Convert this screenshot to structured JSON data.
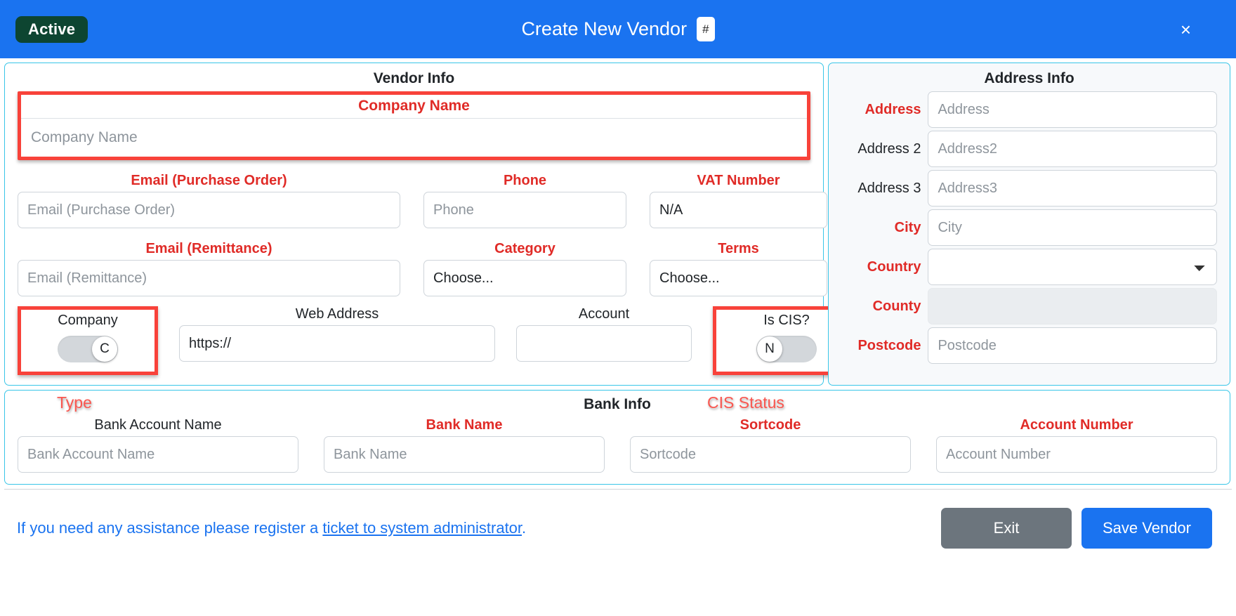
{
  "header": {
    "status_badge": "Active",
    "title": "Create New Vendor",
    "number_badge": "#",
    "close_label": "×",
    "bar_color": "#1a73f0",
    "badge_color": "#0d4531"
  },
  "vendor_info": {
    "title": "Vendor Info",
    "company_name": {
      "label": "Company Name",
      "placeholder": "Company Name",
      "value": "",
      "highlighted": true
    },
    "email_po": {
      "label": "Email (Purchase Order)",
      "placeholder": "Email (Purchase Order)",
      "value": ""
    },
    "phone": {
      "label": "Phone",
      "placeholder": "Phone",
      "value": ""
    },
    "vat_number": {
      "label": "VAT Number",
      "placeholder": "",
      "value": "N/A"
    },
    "email_remittance": {
      "label": "Email (Remittance)",
      "placeholder": "Email (Remittance)",
      "value": ""
    },
    "category": {
      "label": "Category",
      "value": "Choose..."
    },
    "terms": {
      "label": "Terms",
      "value": "Choose..."
    },
    "company_toggle": {
      "label": "Company",
      "state": "on",
      "knob_text": "C",
      "highlighted": true
    },
    "web_address": {
      "label": "Web Address",
      "placeholder": "",
      "value": "https://"
    },
    "account": {
      "label": "Account",
      "placeholder": "",
      "value": ""
    },
    "is_cis_toggle": {
      "label": "Is CIS?",
      "state": "off",
      "knob_text": "N",
      "highlighted": true
    }
  },
  "address_info": {
    "title": "Address Info",
    "fields": [
      {
        "label": "Address",
        "placeholder": "Address",
        "value": "",
        "required": true,
        "type": "text"
      },
      {
        "label": "Address 2",
        "placeholder": "Address2",
        "value": "",
        "required": false,
        "type": "text"
      },
      {
        "label": "Address 3",
        "placeholder": "Address3",
        "value": "",
        "required": false,
        "type": "text"
      },
      {
        "label": "City",
        "placeholder": "City",
        "value": "",
        "required": true,
        "type": "text"
      },
      {
        "label": "Country",
        "placeholder": "",
        "value": "",
        "required": true,
        "type": "select"
      },
      {
        "label": "County",
        "placeholder": "",
        "value": "",
        "required": true,
        "type": "select-disabled"
      },
      {
        "label": "Postcode",
        "placeholder": "Postcode",
        "value": "",
        "required": true,
        "type": "text"
      }
    ]
  },
  "bank_info": {
    "title": "Bank Info",
    "fields": [
      {
        "label": "Bank Account Name",
        "placeholder": "Bank Account Name",
        "value": "",
        "required": false
      },
      {
        "label": "Bank Name",
        "placeholder": "Bank Name",
        "value": "",
        "required": true
      },
      {
        "label": "Sortcode",
        "placeholder": "Sortcode",
        "value": "",
        "required": true
      },
      {
        "label": "Account Number",
        "placeholder": "Account Number",
        "value": "",
        "required": true
      }
    ]
  },
  "annotations": {
    "type": "Type",
    "cis_status": "CIS Status",
    "color": "#fa564f"
  },
  "footer": {
    "assist_prefix": "If you need any assistance please register a ",
    "assist_link": "ticket to system administrator",
    "assist_suffix": ".",
    "exit_label": "Exit",
    "save_label": "Save Vendor",
    "exit_color": "#6c757d",
    "save_color": "#1a73f0"
  }
}
